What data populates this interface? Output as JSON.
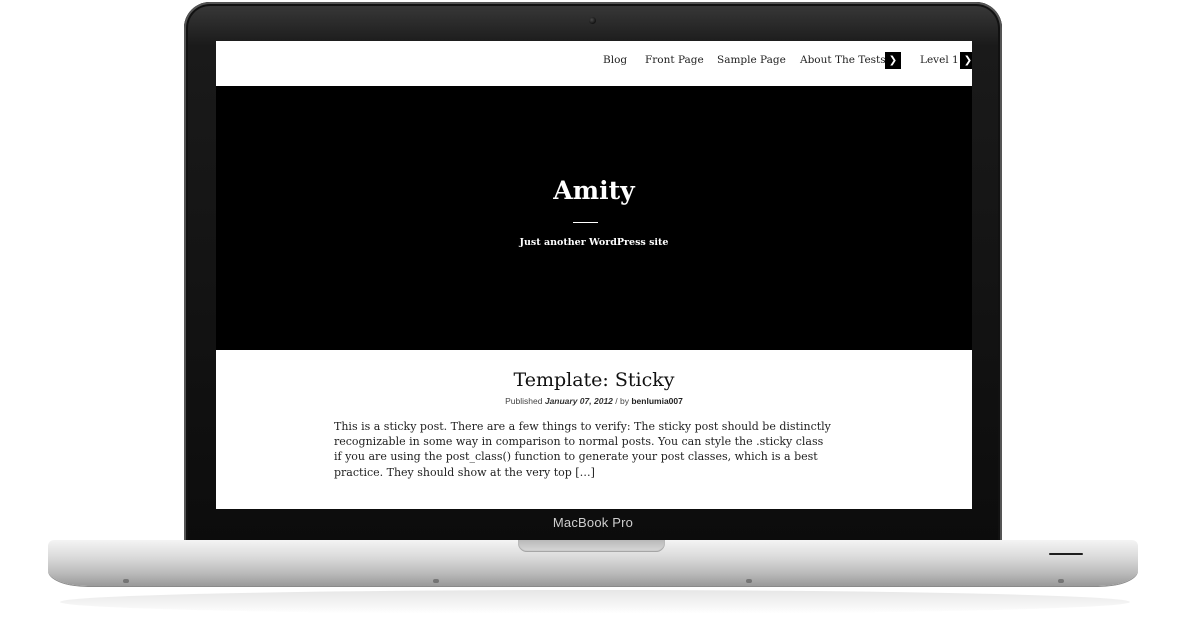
{
  "device": {
    "label": "MacBook Pro"
  },
  "nav": {
    "items": [
      {
        "label": "Blog"
      },
      {
        "label": "Front Page"
      },
      {
        "label": "Sample Page"
      },
      {
        "label": "About The Tests",
        "has_submenu": true
      },
      {
        "label": "Level 1",
        "has_submenu": true
      }
    ],
    "submenu_icon": "chevron-down-icon"
  },
  "site": {
    "title": "Amity",
    "tagline": "Just another WordPress site"
  },
  "post": {
    "title": "Template: Sticky",
    "meta_published": "Published",
    "meta_date": "January 07, 2012",
    "meta_by": "/ by",
    "meta_author": "benlumia007",
    "excerpt": "This is a sticky post. There are a few things to verify: The sticky post should be distinctly recognizable in some way in comparison to normal posts. You can style the .sticky class if you are using the post_class() function to generate your post classes, which is a best practice. They should show at the very top […]"
  },
  "colors": {
    "screen_background": "#000000",
    "nav_background": "#ffffff",
    "post_background": "#ffffff",
    "text": "#222222"
  }
}
